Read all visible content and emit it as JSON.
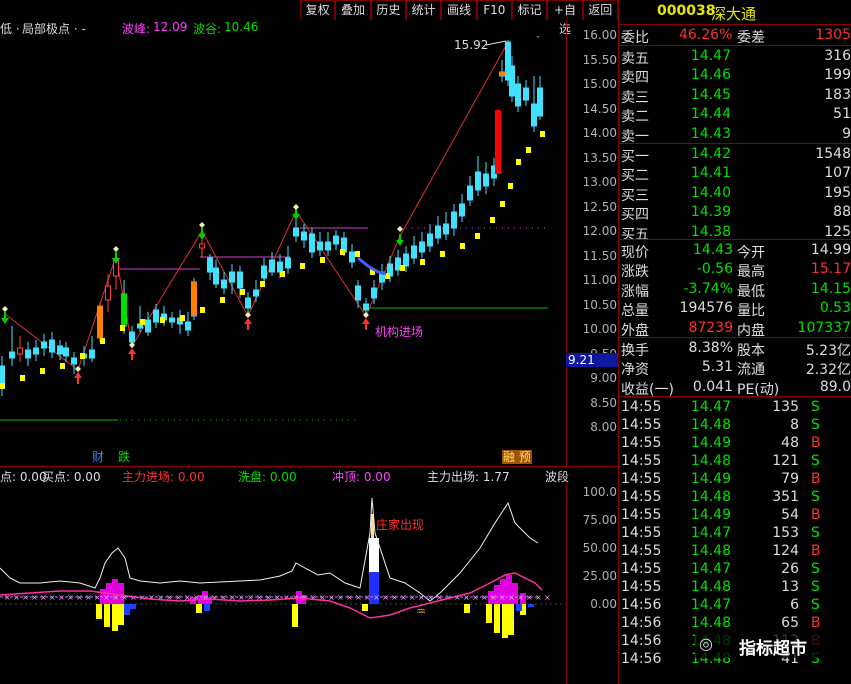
{
  "toolbar": [
    "复权",
    "叠加",
    "历史",
    "统计",
    "画线",
    "F10",
    "标记",
    "+自选",
    "返回"
  ],
  "header": {
    "item1": "低 ·",
    "item2": "局部极点 · -",
    "item3_label": "波峰:",
    "item3_value": "12.09",
    "item4_label": "波谷:",
    "item4_value": "10.46"
  },
  "chart_annotations": {
    "high": "15.92",
    "low_price_box": "9.21",
    "institution": "机构进场",
    "bottom_left": "财",
    "bottom_fall": "跌",
    "bottom_right": "融 预"
  },
  "price_axis": [
    "16.00",
    "15.50",
    "15.00",
    "14.50",
    "14.00",
    "13.50",
    "13.00",
    "12.50",
    "12.00",
    "11.50",
    "11.00",
    "10.50",
    "10.00",
    "9.50",
    "9.00",
    "8.50",
    "8.00"
  ],
  "indicator_header": {
    "i1": "点: 0.00",
    "i2": "买点: 0.00",
    "i3": "主力进场: 0.00",
    "i4": "洗盘: 0.00",
    "i5": "冲顶: 0.00",
    "i6": "主力出场: 1.77",
    "i7": "波段"
  },
  "indicator_annotation": "庄家出现",
  "indicator_axis": [
    "100.0",
    "75.00",
    "50.00",
    "25.00",
    "0.00"
  ],
  "stock": {
    "code": "000038",
    "name": "深大通"
  },
  "committee": {
    "ratio_label": "委比",
    "ratio": "46.26%",
    "diff_label": "委差",
    "diff": "1305"
  },
  "sell": [
    {
      "label": "卖五",
      "price": "14.47",
      "vol": "316"
    },
    {
      "label": "卖四",
      "price": "14.46",
      "vol": "199"
    },
    {
      "label": "卖三",
      "price": "14.45",
      "vol": "183"
    },
    {
      "label": "卖二",
      "price": "14.44",
      "vol": "51"
    },
    {
      "label": "卖一",
      "price": "14.43",
      "vol": "9"
    }
  ],
  "buy": [
    {
      "label": "买一",
      "price": "14.42",
      "vol": "1548"
    },
    {
      "label": "买二",
      "price": "14.41",
      "vol": "107"
    },
    {
      "label": "买三",
      "price": "14.40",
      "vol": "195"
    },
    {
      "label": "买四",
      "price": "14.39",
      "vol": "88"
    },
    {
      "label": "买五",
      "price": "14.38",
      "vol": "125"
    }
  ],
  "quote": [
    {
      "l1": "现价",
      "v1": "14.43",
      "c1": "g",
      "l2": "今开",
      "v2": "14.99",
      "c2": "w"
    },
    {
      "l1": "涨跌",
      "v1": "-0.56",
      "c1": "g",
      "l2": "最高",
      "v2": "15.17",
      "c2": "r"
    },
    {
      "l1": "涨幅",
      "v1": "-3.74%",
      "c1": "g",
      "l2": "最低",
      "v2": "14.15",
      "c2": "g"
    },
    {
      "l1": "总量",
      "v1": "194576",
      "c1": "w",
      "l2": "量比",
      "v2": "0.53",
      "c2": "g"
    },
    {
      "l1": "外盘",
      "v1": "87239",
      "c1": "r",
      "l2": "内盘",
      "v2": "107337",
      "c2": "g"
    }
  ],
  "stats": [
    {
      "l1": "换手",
      "v1": "8.38%",
      "l2": "股本",
      "v2": "5.23亿"
    },
    {
      "l1": "净资",
      "v1": "5.31",
      "l2": "流通",
      "v2": "2.32亿"
    },
    {
      "l1": "收益(一)",
      "v1": "0.041",
      "l2": "PE(动)",
      "v2": "89.0"
    }
  ],
  "ticks": [
    {
      "time": "14:55",
      "price": "14.47",
      "vol": "135",
      "side": "S"
    },
    {
      "time": "14:55",
      "price": "14.48",
      "vol": "8",
      "side": "S"
    },
    {
      "time": "14:55",
      "price": "14.49",
      "vol": "48",
      "side": "B"
    },
    {
      "time": "14:55",
      "price": "14.48",
      "vol": "121",
      "side": "S"
    },
    {
      "time": "14:55",
      "price": "14.49",
      "vol": "79",
      "side": "B"
    },
    {
      "time": "14:55",
      "price": "14.48",
      "vol": "351",
      "side": "S"
    },
    {
      "time": "14:55",
      "price": "14.49",
      "vol": "54",
      "side": "B"
    },
    {
      "time": "14:55",
      "price": "14.47",
      "vol": "153",
      "side": "S"
    },
    {
      "time": "14:55",
      "price": "14.48",
      "vol": "124",
      "side": "B"
    },
    {
      "time": "14:55",
      "price": "14.47",
      "vol": "26",
      "side": "S"
    },
    {
      "time": "14:55",
      "price": "14.48",
      "vol": "13",
      "side": "S"
    },
    {
      "time": "14:56",
      "price": "14.47",
      "vol": "6",
      "side": "S"
    },
    {
      "time": "14:56",
      "price": "14.48",
      "vol": "65",
      "side": "B"
    },
    {
      "time": "14:56",
      "price": "14.48",
      "vol": "112",
      "side": "B"
    },
    {
      "time": "14:56",
      "price": "14.48",
      "vol": "41",
      "side": "S"
    }
  ],
  "watermark": "指标超市"
}
